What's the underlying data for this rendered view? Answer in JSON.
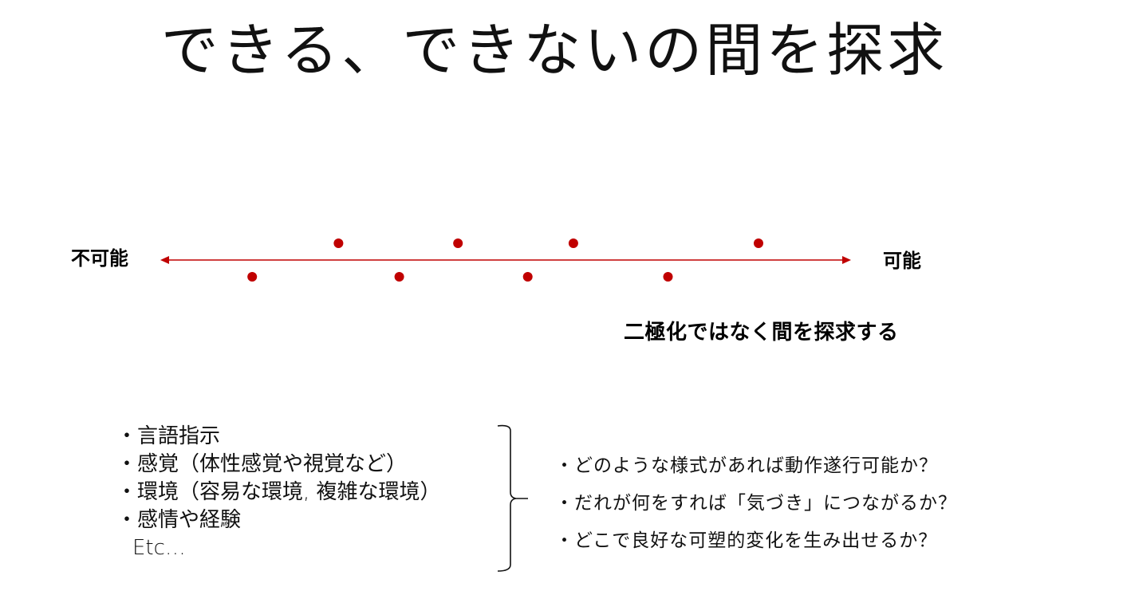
{
  "slide": {
    "title": "できる、できないの間を探求",
    "axis": {
      "left_label": "不可能",
      "right_label": "可能",
      "color": "#c00000",
      "arrow": "double-headed",
      "points": [
        {
          "position": 0.133,
          "side": "below"
        },
        {
          "position": 0.258,
          "side": "above"
        },
        {
          "position": 0.346,
          "side": "below"
        },
        {
          "position": 0.431,
          "side": "above"
        },
        {
          "position": 0.532,
          "side": "below"
        },
        {
          "position": 0.598,
          "side": "above"
        },
        {
          "position": 0.735,
          "side": "below"
        },
        {
          "position": 0.866,
          "side": "above"
        }
      ]
    },
    "subtitle": "二極化ではなく間を探求する",
    "factors": [
      "・言語指示",
      "・感覚（体性感覚や視覚など）",
      "・環境（容易な環境, 複雑な環境）",
      "・感情や経験",
      "Etc…"
    ],
    "bracket": {
      "icon": "right-curly-brace"
    },
    "questions": [
      "・どのような様式があれば動作遂行可能か？",
      "・だれが何をすれば「気づき」につながるか？",
      "・どこで良好な可塑的変化を生み出せるか？"
    ]
  }
}
